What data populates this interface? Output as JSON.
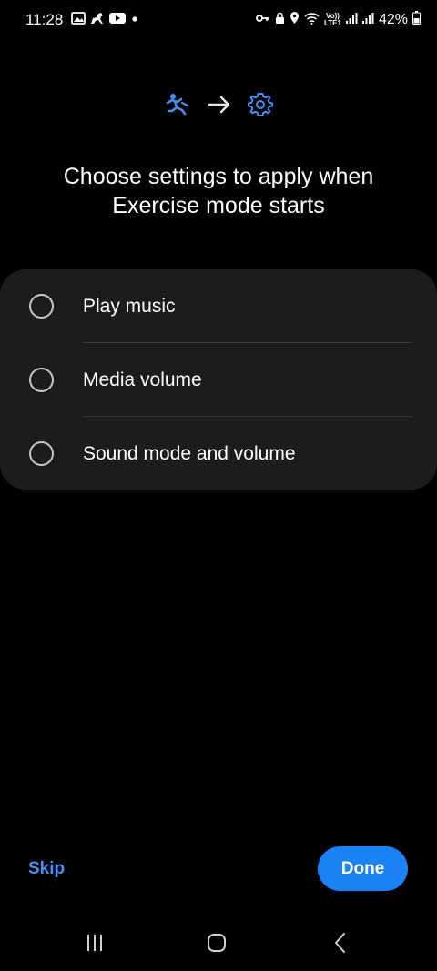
{
  "status_bar": {
    "time": "11:28",
    "left_icons": [
      "gallery-icon",
      "horse-icon",
      "youtube-icon",
      "notification-dot-icon"
    ],
    "right_icons": [
      "key-icon",
      "lock-icon",
      "location-icon",
      "wifi-icon",
      "volte-icon",
      "signal-icon",
      "signal-icon",
      "battery-icon"
    ],
    "volte_top": "Vo))",
    "volte_bottom": "LTE1",
    "battery": "42%"
  },
  "hero": {
    "icons": [
      "exercise-icon",
      "arrow-right-icon",
      "settings-gear-icon"
    ],
    "accent_color": "#4a8ff0"
  },
  "title": {
    "line1": "Choose settings to apply when",
    "line2": "Exercise mode starts"
  },
  "options": [
    {
      "label": "Play music",
      "selected": false
    },
    {
      "label": "Media volume",
      "selected": false
    },
    {
      "label": "Sound mode and volume",
      "selected": false
    }
  ],
  "footer": {
    "skip_label": "Skip",
    "done_label": "Done",
    "done_color": "#1a82f5"
  },
  "nav_bar": {
    "buttons": [
      "recents-icon",
      "home-icon",
      "back-icon"
    ]
  }
}
